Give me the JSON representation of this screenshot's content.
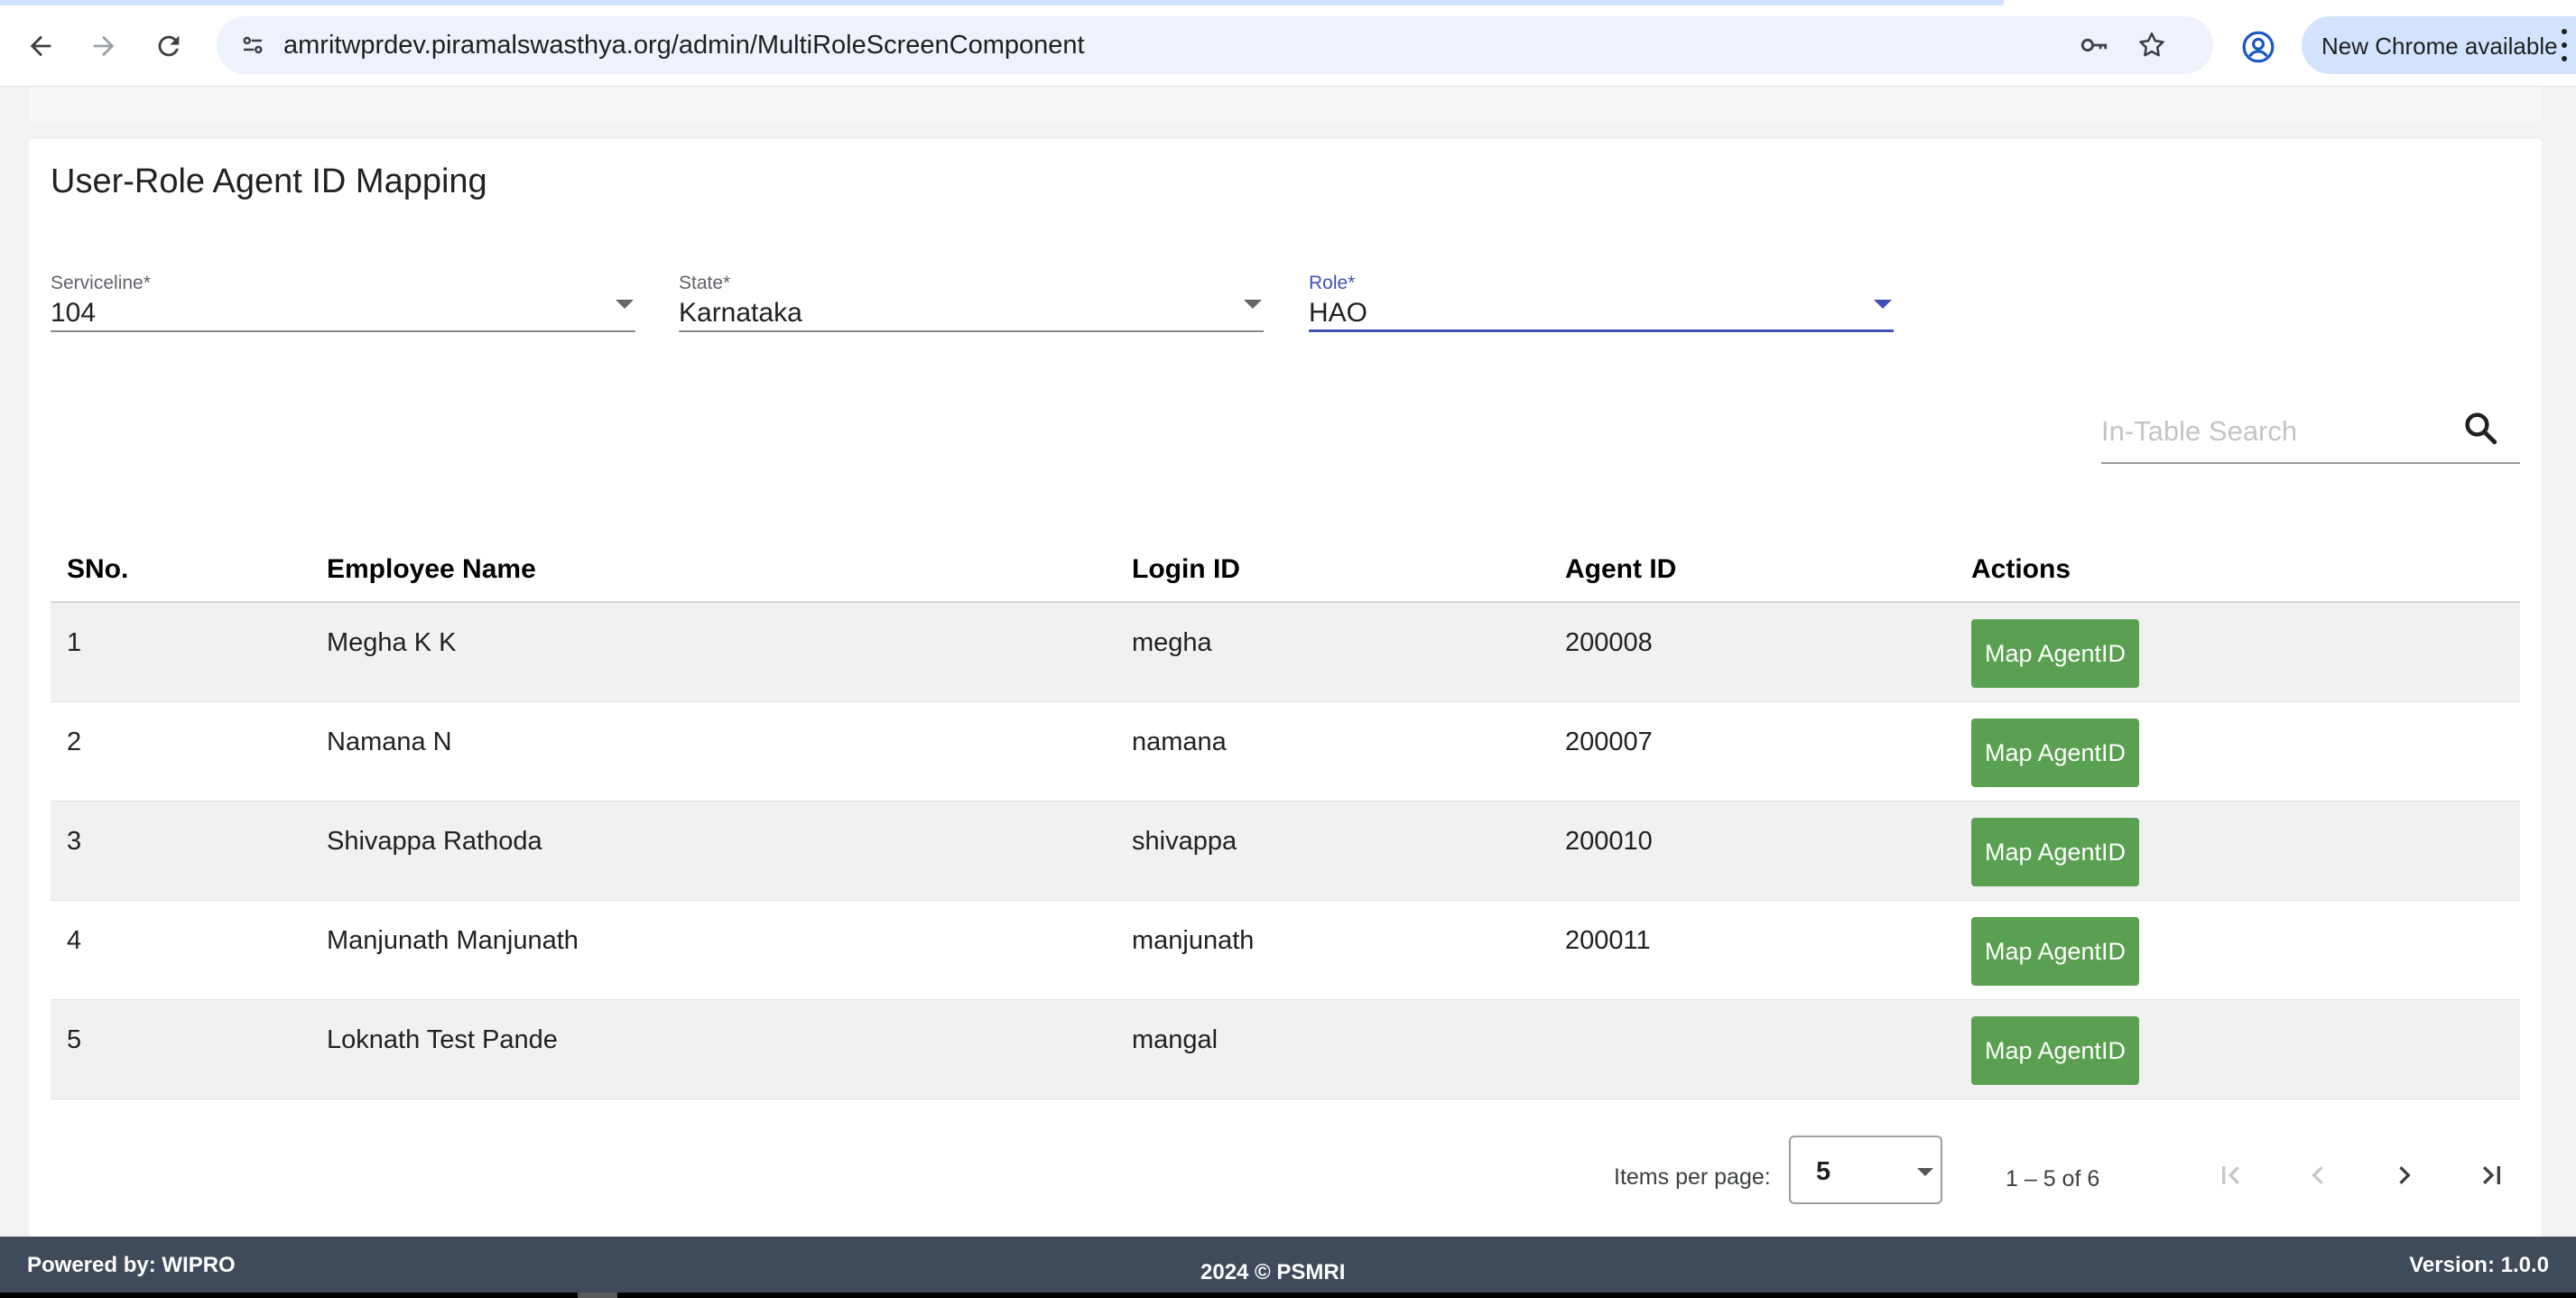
{
  "browser": {
    "url": "amritwprdev.piramalswasthya.org/admin/MultiRoleScreenComponent",
    "update_label": "New Chrome available"
  },
  "page": {
    "title": "User-Role Agent ID Mapping"
  },
  "filters": {
    "serviceline": {
      "label": "Serviceline*",
      "value": "104"
    },
    "state": {
      "label": "State*",
      "value": "Karnataka"
    },
    "role": {
      "label": "Role*",
      "value": "HAO"
    }
  },
  "search": {
    "placeholder": "In-Table Search"
  },
  "table": {
    "headers": {
      "sno": "SNo.",
      "employee_name": "Employee Name",
      "login_id": "Login ID",
      "agent_id": "Agent ID",
      "actions": "Actions"
    },
    "action_label": "Map AgentID",
    "rows": [
      {
        "sno": "1",
        "employee_name": "Megha K K",
        "login_id": "megha",
        "agent_id": "200008"
      },
      {
        "sno": "2",
        "employee_name": "Namana N",
        "login_id": "namana",
        "agent_id": "200007"
      },
      {
        "sno": "3",
        "employee_name": "Shivappa Rathoda",
        "login_id": "shivappa",
        "agent_id": "200010"
      },
      {
        "sno": "4",
        "employee_name": "Manjunath Manjunath",
        "login_id": "manjunath",
        "agent_id": "200011"
      },
      {
        "sno": "5",
        "employee_name": "Loknath Test Pande",
        "login_id": "mangal",
        "agent_id": ""
      }
    ]
  },
  "paginator": {
    "items_per_page_label": "Items per page:",
    "items_per_page_value": "5",
    "range_label": "1 – 5 of 6"
  },
  "footer": {
    "powered_by": "Powered by: WIPRO",
    "copyright": "2024  ©  PSMRI",
    "version": "Version: 1.0.0"
  },
  "colors": {
    "action_button": "#5aa051",
    "active_field": "#3f51b5",
    "footer_bg": "#3f4b5b"
  }
}
